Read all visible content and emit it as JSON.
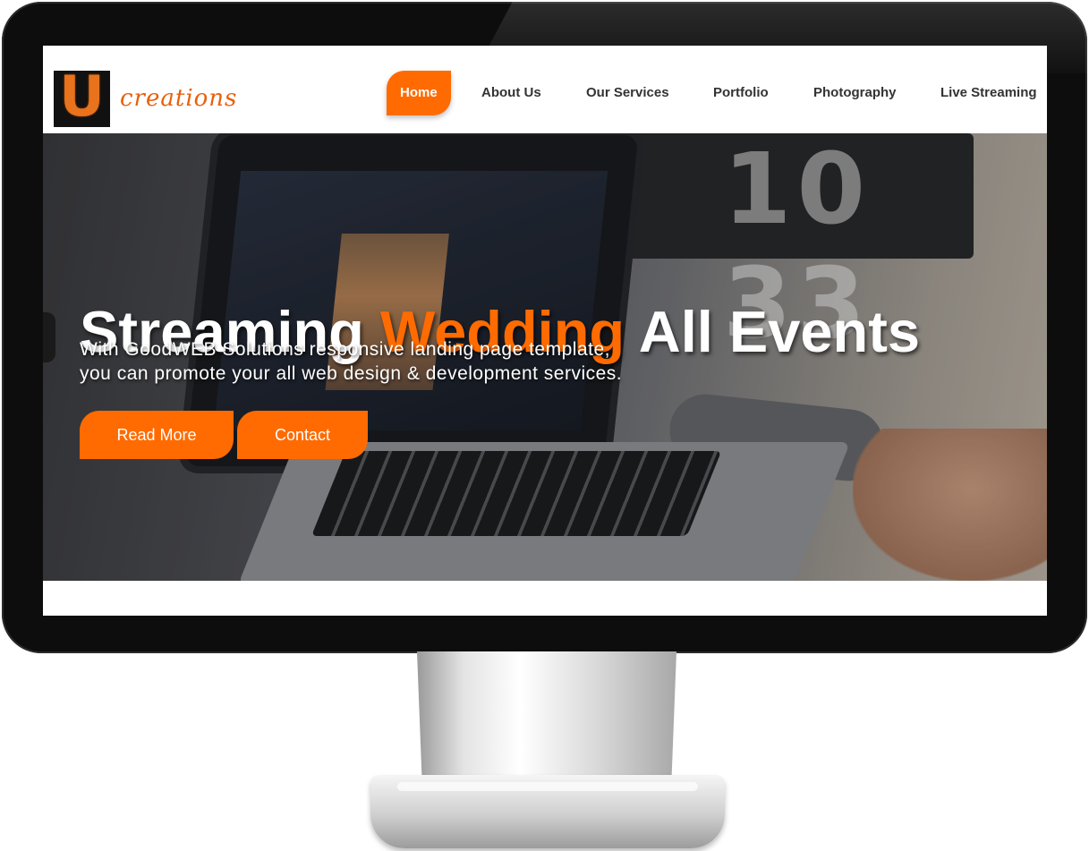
{
  "brand": {
    "logo_letter": "U",
    "logo_text": "creations",
    "accent_color": "#ff6b00"
  },
  "nav": {
    "items": [
      {
        "label": "Home",
        "active": true
      },
      {
        "label": "About Us",
        "active": false
      },
      {
        "label": "Our Services",
        "active": false
      },
      {
        "label": "Portfolio",
        "active": false
      },
      {
        "label": "Photography",
        "active": false
      },
      {
        "label": "Live Streaming",
        "active": false
      }
    ]
  },
  "hero": {
    "title_part1": "Streaming",
    "title_highlight": "Wedding",
    "title_part2": "All Events",
    "subtitle_line1": "With GoodWEB Solutions responsive landing page template,",
    "subtitle_line2": "you can promote your all web design & development services.",
    "primary_button": "Read More",
    "secondary_button": "Contact",
    "background_clock_text": "10 33"
  }
}
